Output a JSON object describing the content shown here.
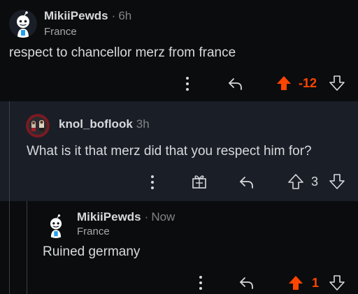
{
  "colors": {
    "background": "#0b0c0e",
    "highlight_background": "#1a1e27",
    "text": "#d7dadc",
    "muted_text": "#818384",
    "upvote_active": "#ff4500"
  },
  "comments": [
    {
      "author": "MikiiPewds",
      "separator": "·",
      "time": "6h",
      "flair": "France",
      "body": "respect to chancellor merz from france",
      "score": "-12",
      "upvoted": true,
      "icons": [
        "snoo-avatar-icon",
        "more-options-icon",
        "reply-icon",
        "upvote-icon",
        "downvote-icon"
      ]
    },
    {
      "author": "knol_boflook",
      "time": "3h",
      "body": "What is it that merz did that you respect him for?",
      "score": "3",
      "upvoted": false,
      "icons": [
        "user-avatar-icon",
        "more-options-icon",
        "award-gift-icon",
        "reply-icon",
        "upvote-icon",
        "downvote-icon"
      ]
    },
    {
      "author": "MikiiPewds",
      "separator": "·",
      "time": "Now",
      "flair": "France",
      "body": "Ruined germany",
      "score": "1",
      "upvoted": true,
      "icons": [
        "snoo-avatar-icon",
        "more-options-icon",
        "reply-icon",
        "upvote-icon",
        "downvote-icon"
      ]
    }
  ]
}
